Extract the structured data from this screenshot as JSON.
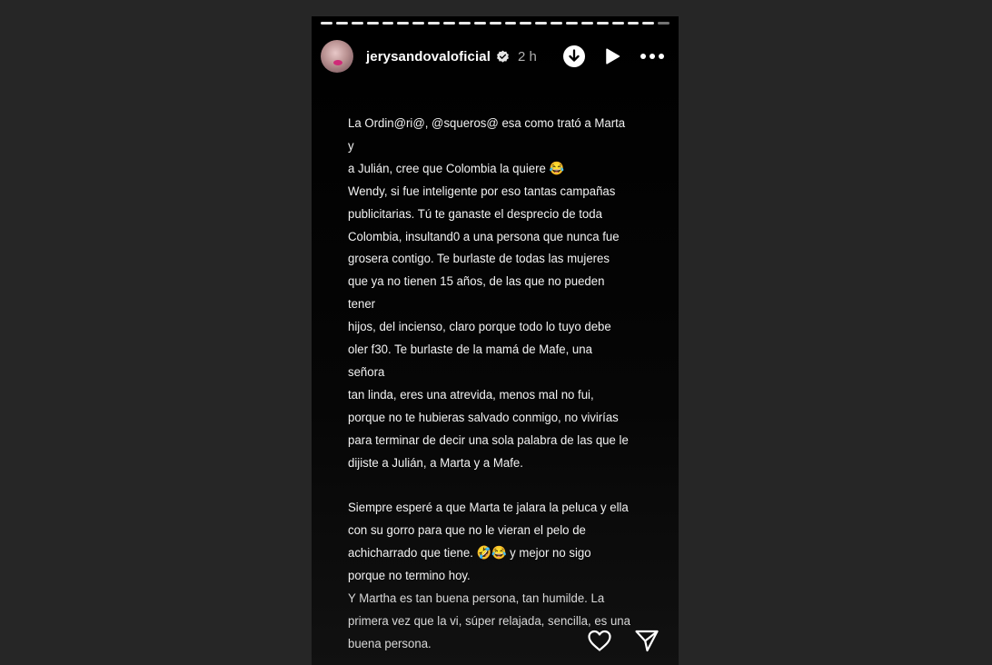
{
  "story": {
    "username": "jerysandovaloficial",
    "time": "2 h",
    "progress_segments": 23,
    "icons": {
      "avatar": "profile-avatar",
      "verified": "verified-badge-icon",
      "download": "download-icon",
      "play": "play-icon",
      "more": "more-options-icon",
      "like": "heart-icon",
      "share": "send-icon"
    },
    "text_lines": [
      "La Ordin@ri@, @squeros@ esa como trató a Marta y",
      "a Julián, cree que Colombia la quiere 😂",
      "Wendy, si fue inteligente por eso tantas campañas",
      "publicitarias. Tú te ganaste el desprecio de toda",
      "Colombia, insultand0 a una persona que nunca fue",
      "grosera contigo. Te burlaste de todas las mujeres",
      "que ya no tienen 15 años, de las que no pueden tener",
      "hijos, del incienso, claro porque todo lo tuyo debe",
      "oler f30. Te burlaste de la mamá de Mafe, una señora",
      "tan linda, eres una atrevida, menos mal no fui,",
      "porque no te hubieras salvado conmigo, no vivirías",
      "para terminar de decir una sola palabra de las que le",
      "dijiste a Julián, a Marta y a Mafe.",
      "",
      "Siempre esperé a que Marta te jalara la peluca y ella",
      "con su gorro para que no le vieran el pelo de",
      "achicharrado que tiene. 🤣😂 y mejor no sigo",
      "porque no termino hoy.",
      "Y Martha es tan buena persona, tan humilde. La",
      "primera vez que la vi, súper relajada, sencilla, es una",
      "buena persona."
    ]
  }
}
